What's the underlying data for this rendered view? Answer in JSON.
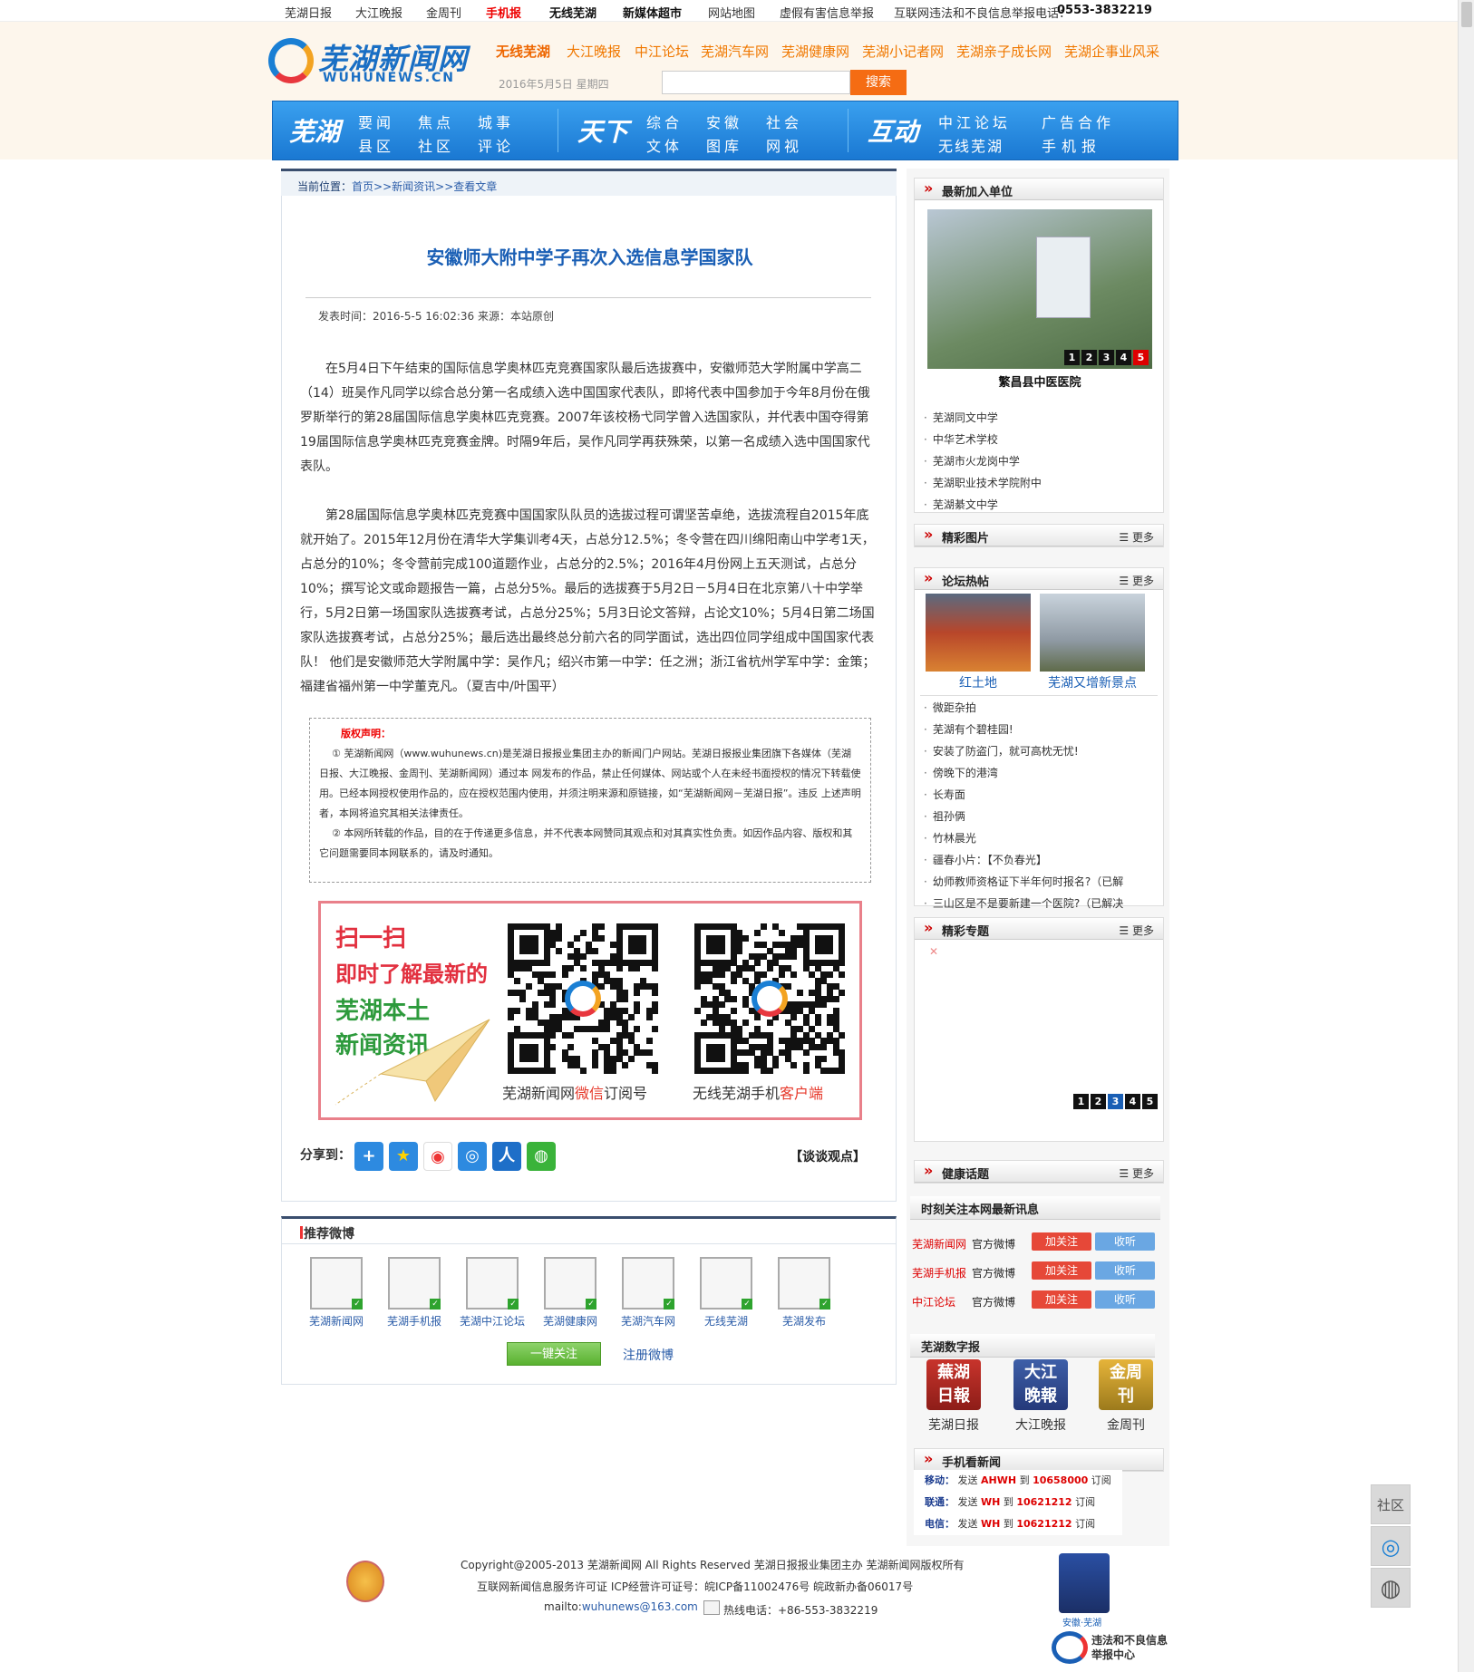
{
  "topbar": {
    "links": [
      "芜湖日报",
      "大江晚报",
      "金周刊",
      "手机报",
      "无线芜湖",
      "新媒体超市",
      "网站地图",
      "虚假有害信息举报"
    ],
    "report_label": "互联网违法和不良信息举报电话：",
    "report_phone": "0553-3832219"
  },
  "header": {
    "logo_cn": "芜湖新闻网",
    "logo_en": "WUHUNEWS.CN",
    "site_links": [
      "无线芜湖",
      "大江晚报",
      "中江论坛",
      "芜湖汽车网",
      "芜湖健康网",
      "芜湖小记者网",
      "芜湖亲子成长网",
      "芜湖企事业风采"
    ],
    "date": "2016年5月5日 星期四",
    "search_placeholder": "",
    "search_button": "搜索"
  },
  "nav": {
    "badges": [
      "芜湖",
      "天下",
      "互动"
    ],
    "group1": [
      "要闻",
      "焦点",
      "城事",
      "县区",
      "社区",
      "评论"
    ],
    "group2": [
      "综合",
      "安徽",
      "社会",
      "文体",
      "图库",
      "网视"
    ],
    "group3": [
      "中江论坛",
      "广告合作",
      "无线芜湖",
      "手机报"
    ]
  },
  "breadcrumb": {
    "label": "当前位置：",
    "items": [
      "首页",
      ">>新闻资讯",
      ">>查看文章"
    ]
  },
  "article": {
    "title": "安徽师大附中学子再次入选信息学国家队",
    "meta": "发表时间：2016-5-5 16:02:36 来源：本站原创",
    "para1": "在5月4日下午结束的国际信息学奥林匹克竞赛国家队最后选拔赛中，安徽师范大学附属中学高二（14）班吴作凡同学以综合总分第一名成绩入选中国国家代表队，即将代表中国参加于今年8月份在俄罗斯举行的第28届国际信息学奥林匹克竞赛。2007年该校杨弋同学曾入选国家队，并代表中国夺得第19届国际信息学奥林匹克竞赛金牌。时隔9年后，吴作凡同学再获殊荣，以第一名成绩入选中国国家代表队。",
    "para2": "第28届国际信息学奥林匹克竞赛中国国家队队员的选拔过程可谓坚苦卓绝，选拔流程自2015年底就开始了。2015年12月份在清华大学集训考4天，占总分12.5%；冬令营在四川绵阳南山中学考1天，占总分的10%；冬令营前完成100道题作业，占总分的2.5%；2016年4月份网上五天测试，占总分10%；撰写论文或命题报告一篇，占总分5%。最后的选拔赛于5月2日－5月4日在北京第八十中学举行，5月2日第一场国家队选拔赛考试，占总分25%；5月3日论文答辩，占论文10%；5月4日第二场国家队选拔赛考试，占总分25%；最后选出最终总分前六名的同学面试，选出四位同学组成中国国家代表队！ 他们是安徽师范大学附属中学：吴作凡；绍兴市第一中学：任之洲；浙江省杭州学军中学：金策；福建省福州第一中学董克凡。（夏吉中/叶国平）"
  },
  "notice": {
    "title": "版权声明：",
    "p1": "① 芜湖新闻网（www.wuhunews.cn)是芜湖日报报业集团主办的新闻门户网站。芜湖日报报业集团旗下各媒体（芜湖日报、大江晚报、金周刊、芜湖新闻网）通过本 网发布的作品，禁止任何媒体、网站或个人在未经书面授权的情况下转载使用。已经本网授权使用作品的，应在授权范围内使用，并须注明来源和原链接，如“芜湖新闻网－芜湖日报”。违反 上述声明者，本网将追究其相关法律责任。",
    "p2": "② 本网所转载的作品，目的在于传递更多信息，并不代表本网赞同其观点和对其真实性负责。如因作品内容、版权和其它问题需要同本网联系的，请及时通知。"
  },
  "qr_promo": {
    "slogan": [
      "扫一扫",
      "即时了解最新的",
      "芜湖本土",
      "新闻资讯"
    ],
    "cap1_a": "芜湖新闻网",
    "cap1_b": "微信",
    "cap1_c": "订阅号",
    "cap2_a": "无线芜湖手机",
    "cap2_b": "客户端"
  },
  "share": {
    "label": "分享到：",
    "talk": "【谈谈观点】"
  },
  "weibo": {
    "title": "推荐微博",
    "accounts": [
      "芜湖新闻网",
      "芜湖手机报",
      "芜湖中江论坛",
      "芜湖健康网",
      "芜湖汽车网",
      "无线芜湖",
      "芜湖发布"
    ],
    "follow_all": "一键关注",
    "register": "注册微博"
  },
  "sidebar": {
    "new_units_title": "最新加入单位",
    "new_units_caption": "繁昌县中医医院",
    "new_units_pager": [
      "1",
      "2",
      "3",
      "4",
      "5"
    ],
    "new_units_list": [
      "芜湖同文中学",
      "中华艺术学校",
      "芜湖市火龙岗中学",
      "芜湖职业技术学院附中",
      "芜湖綦文中学"
    ],
    "photos_title": "精彩图片",
    "more": "更多",
    "forum_title": "论坛热帖",
    "forum_pic1": "红土地",
    "forum_pic2": "芜湖又增新景点",
    "forum_list": [
      "微距杂拍",
      "芜湖有个碧桂园!",
      "安装了防盗门，就可高枕无忧!",
      "傍晚下的港湾",
      "长寿面",
      "祖孙俩",
      "竹林晨光",
      "疆春小片：【不负春光】",
      "幼师教师资格证下半年何时报名?（已解",
      "三山区是不是要新建一个医院?（已解决"
    ],
    "topics_title": "精彩专题",
    "topics_pager": [
      "1",
      "2",
      "3",
      "4",
      "5"
    ],
    "health_title": "健康话题",
    "follow_title": "时刻关注本网最新讯息",
    "follow_rows": [
      {
        "name": "芜湖新闻网",
        "type": "官方微博"
      },
      {
        "name": "芜湖手机报",
        "type": "官方微博"
      },
      {
        "name": "中江论坛",
        "type": "官方微博"
      }
    ],
    "follow_btn": "加关注",
    "listen_btn": "收听",
    "digital_title": "芜湖数字报",
    "papers": [
      "芜湖日报",
      "大江晚报",
      "金周刊"
    ],
    "mobile_title": "手机看新闻",
    "sms": [
      {
        "carrier": "移动：",
        "send": "发送",
        "kw": "AHWH",
        "to": "到",
        "num": "10658000",
        "sub": "订阅"
      },
      {
        "carrier": "联通：",
        "send": "发送",
        "kw": "WH",
        "to": "到",
        "num": "10621212",
        "sub": "订阅"
      },
      {
        "carrier": "电信：",
        "send": "发送",
        "kw": "WH",
        "to": "到",
        "num": "10621212",
        "sub": "订阅"
      }
    ]
  },
  "footer": {
    "line1": "Copyright@2005-2013 芜湖新闻网  All Rights Reserved 芜湖日报报业集团主办  芜湖新闻网版权所有",
    "line2": "互联网新闻信息服务许可证  ICP经营许可证号：皖ICP备11002476号 皖政新办备06017号",
    "mail_label": "mailto:",
    "mail": "wuhunews@163.com",
    "hotline": "热线电话：+86-553-3832219",
    "badge_right_top": "安徽·芜湖",
    "badge_right_bottom": "违法和不良信息举报中心"
  },
  "float_bar": {
    "community": "社区"
  }
}
